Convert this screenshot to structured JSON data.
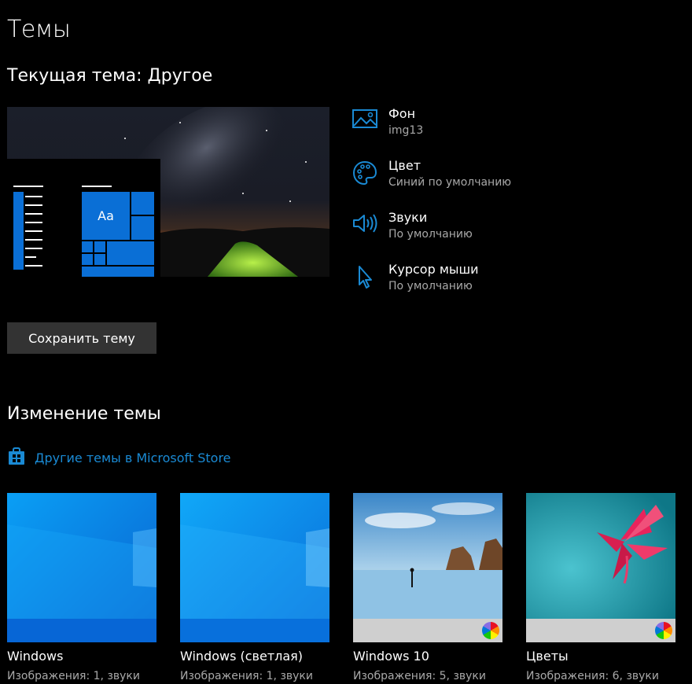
{
  "page": {
    "title": "Темы",
    "current_theme": "Текущая тема: Другое",
    "save_button": "Сохранить тему",
    "change_heading": "Изменение темы",
    "store_link": "Другие темы в Microsoft Store"
  },
  "preview": {
    "tile_text": "Aa"
  },
  "properties": [
    {
      "label": "Фон",
      "value": "img13",
      "icon": "picture-icon"
    },
    {
      "label": "Цвет",
      "value": "Синий по умолчанию",
      "icon": "palette-icon"
    },
    {
      "label": "Звуки",
      "value": "По умолчанию",
      "icon": "speaker-icon"
    },
    {
      "label": "Курсор мыши",
      "value": "По умолчанию",
      "icon": "cursor-icon"
    }
  ],
  "themes": [
    {
      "name": "Windows",
      "desc": "Изображения: 1, звуки"
    },
    {
      "name": "Windows (светлая)",
      "desc": "Изображения: 1, звуки"
    },
    {
      "name": "Windows 10",
      "desc": "Изображения: 5, звуки"
    },
    {
      "name": "Цветы",
      "desc": "Изображения: 6, звуки"
    }
  ],
  "colors": {
    "accent": "#0a6fd6",
    "link": "#1a8ad4",
    "secondary_text": "#a8a8a8",
    "button_bg": "#333333"
  }
}
